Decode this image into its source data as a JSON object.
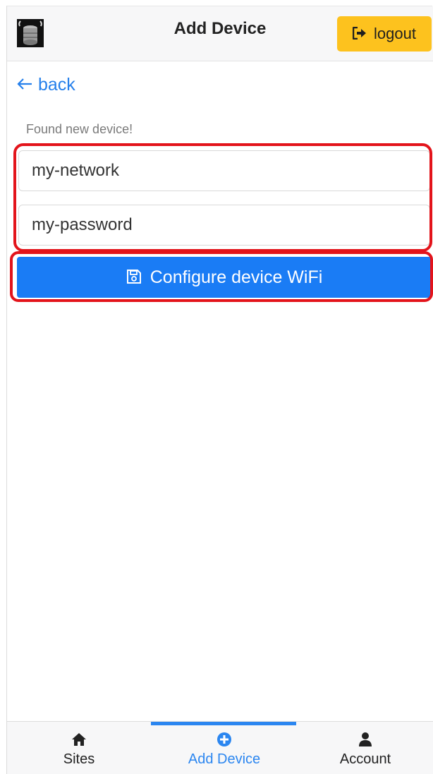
{
  "header": {
    "title": "Add Device",
    "logo_icon": "device-logo-icon",
    "logout": {
      "label": "logout",
      "icon": "sign-out-icon",
      "color": "#fdc21e"
    }
  },
  "back": {
    "label": "back",
    "icon": "arrow-left-icon"
  },
  "form": {
    "status_text": "Found new device!",
    "ssid_value": "my-network",
    "password_value": "my-password",
    "submit_label": "Configure device WiFi",
    "submit_icon": "save-icon",
    "accent_color": "#1a7cf5",
    "highlight_color": "#e3141b"
  },
  "nav": {
    "items": [
      {
        "label": "Sites",
        "icon": "home-icon",
        "active": false
      },
      {
        "label": "Add Device",
        "icon": "plus-circle-icon",
        "active": true
      },
      {
        "label": "Account",
        "icon": "user-icon",
        "active": false
      }
    ]
  }
}
